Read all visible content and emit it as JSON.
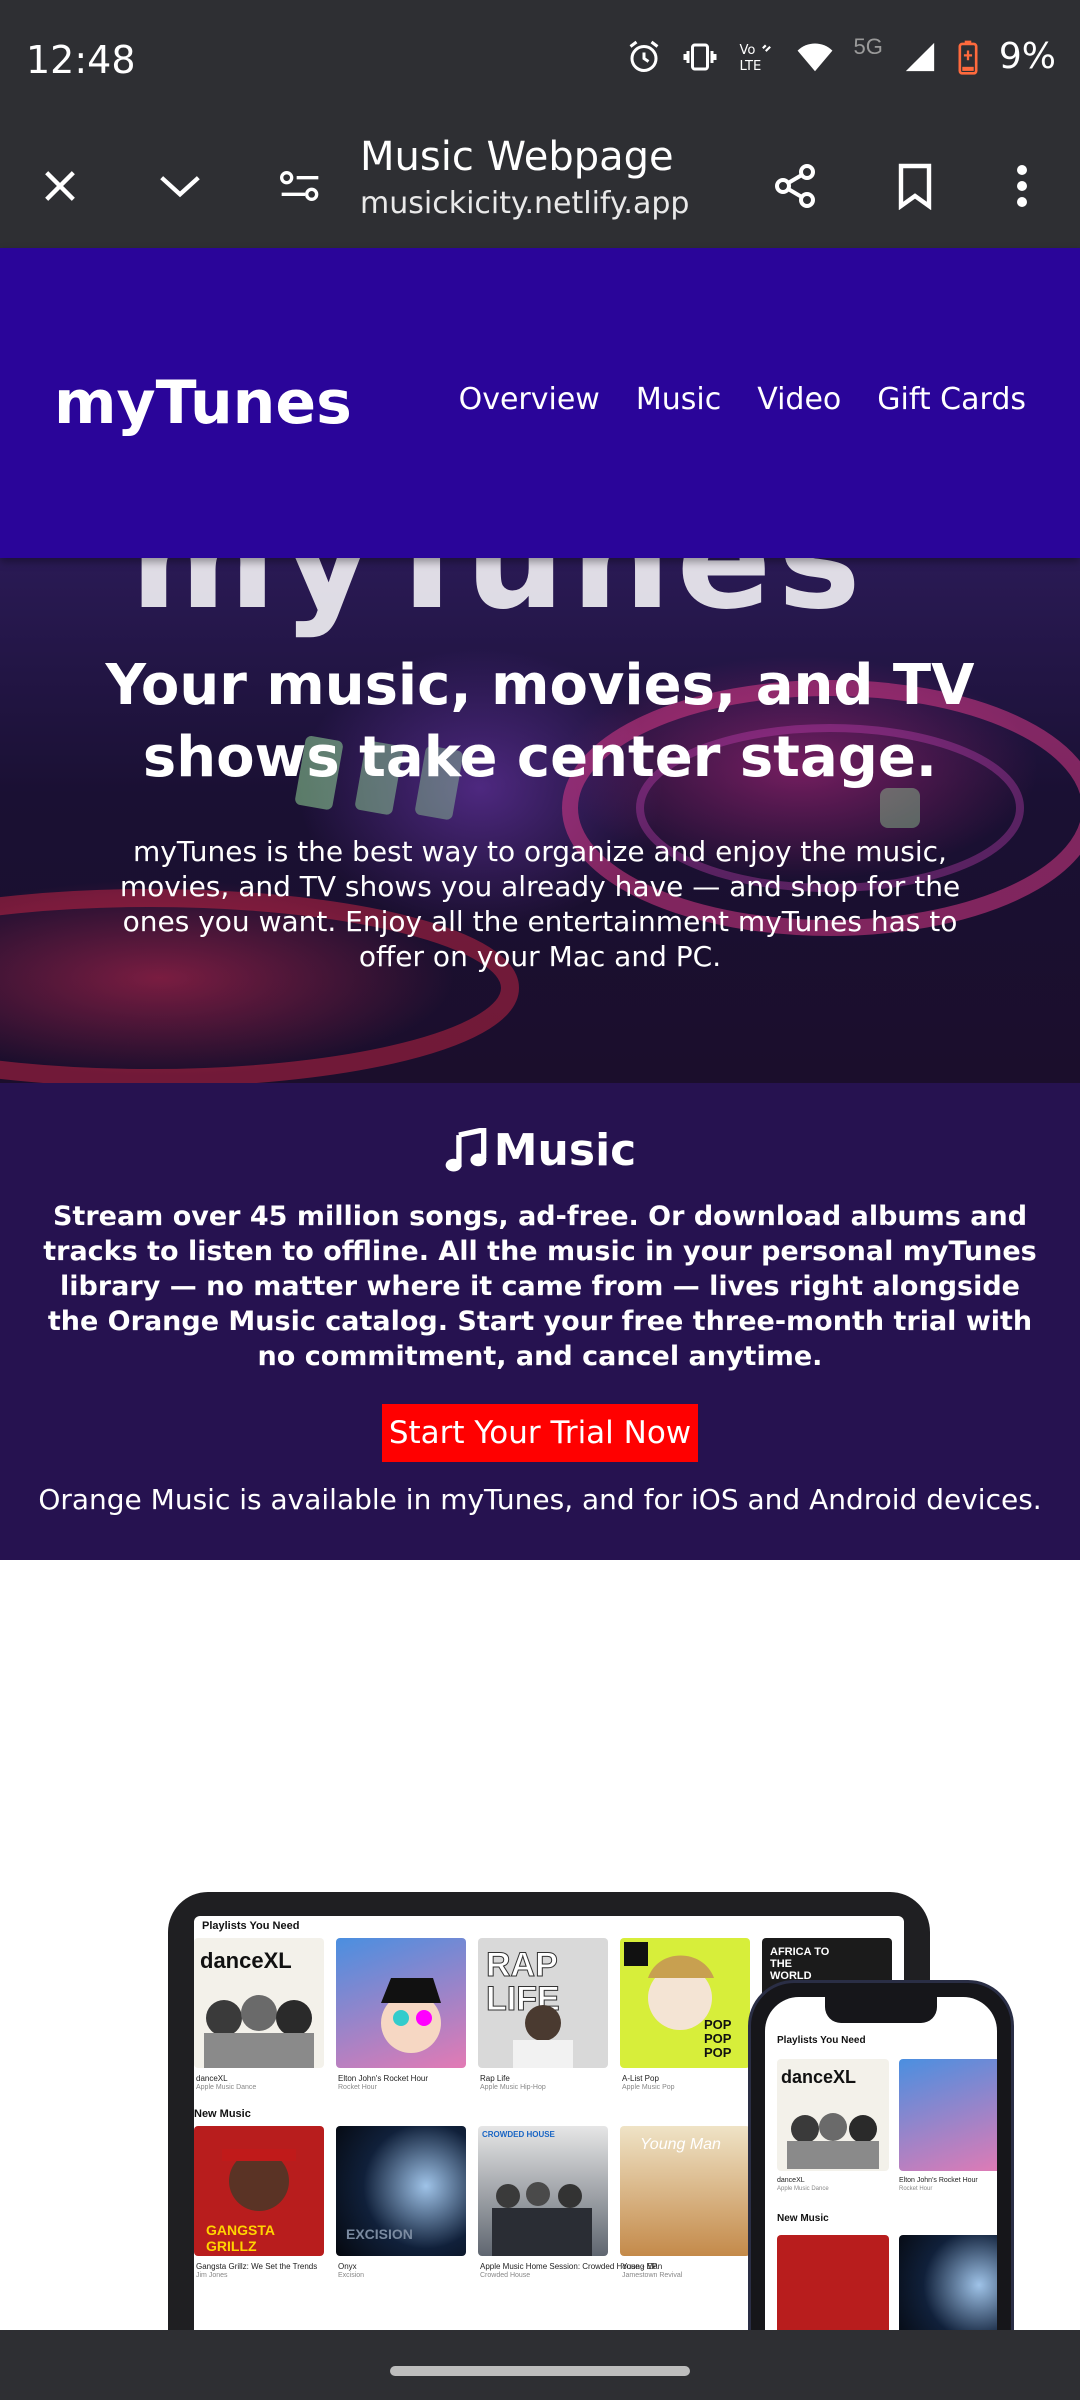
{
  "status_bar": {
    "time": "12:48",
    "network": "5G",
    "battery": "9%",
    "icons": [
      "alarm-icon",
      "vibrate-icon",
      "volte-icon",
      "wifi-icon",
      "signal-icon",
      "battery-icon"
    ]
  },
  "browser": {
    "page_title": "Music Webpage",
    "url": "musickicity.netlify.app",
    "icons": [
      "close-icon",
      "chevron-down-icon",
      "page-settings-icon",
      "share-icon",
      "bookmark-icon",
      "more-vert-icon"
    ]
  },
  "site": {
    "brand": "myTunes",
    "nav": [
      {
        "label": "Overview"
      },
      {
        "label": "Music"
      },
      {
        "label": "Video"
      },
      {
        "label": "Gift Cards"
      }
    ],
    "colors": {
      "nav_bg": "#2a0599",
      "music_bg": "#261250",
      "cta": "#ff0000"
    }
  },
  "hero": {
    "title": "Your music, movies, and TV shows take center stage.",
    "text": "myTunes is the best way to organize and enjoy the music, movies, and TV shows you already have — and shop for the ones you want. Enjoy all the entertainment myTunes has to offer on your Mac and PC."
  },
  "music": {
    "heading": "Music",
    "body": "Stream over 45 million songs, ad-free. Or download albums and tracks to listen to offline. All the music in your personal myTunes library — no matter where it came from — lives right alongside the Orange Music catalog. Start your free three-month trial with no commitment, and cancel anytime.",
    "cta": "Start Your Trial Now",
    "note": "Orange Music is available in myTunes, and for iOS and Android devices."
  },
  "devices": {
    "tablet": {
      "section1": "Playlists You Need",
      "section2": "New Music",
      "playlists": [
        {
          "art": "danceXL",
          "title": "danceXL",
          "sub": "Apple Music Dance"
        },
        {
          "art": "",
          "title": "Elton John's Rocket Hour",
          "sub": "Rocket Hour"
        },
        {
          "art": "RAP LIFE",
          "title": "Rap Life",
          "sub": "Apple Music Hip-Hop"
        },
        {
          "art": "POP POP POP",
          "title": "A-List Pop",
          "sub": "Apple Music Pop"
        },
        {
          "art": "AFRICA TO THE WORLD",
          "title": "",
          "sub": ""
        }
      ],
      "new_music": [
        {
          "art": "GANGSTA GRILLZ",
          "title": "Gangsta Grillz: We Set the Trends",
          "sub": "Jim Jones"
        },
        {
          "art": "EXCISION",
          "title": "Onyx",
          "sub": "Excision"
        },
        {
          "art": "CROWDED HOUSE",
          "title": "Apple Music Home Session: Crowded House - EP",
          "sub": "Crowded House"
        },
        {
          "art": "Young Man",
          "title": "Young Man",
          "sub": "Jamestown Revival"
        }
      ]
    },
    "phone": {
      "section1": "Playlists You Need",
      "section2": "New Music",
      "playlists": [
        {
          "title": "danceXL",
          "sub": "Apple Music Dance"
        },
        {
          "title": "Elton John's Rocket Hour",
          "sub": "Rocket Hour"
        }
      ]
    }
  }
}
